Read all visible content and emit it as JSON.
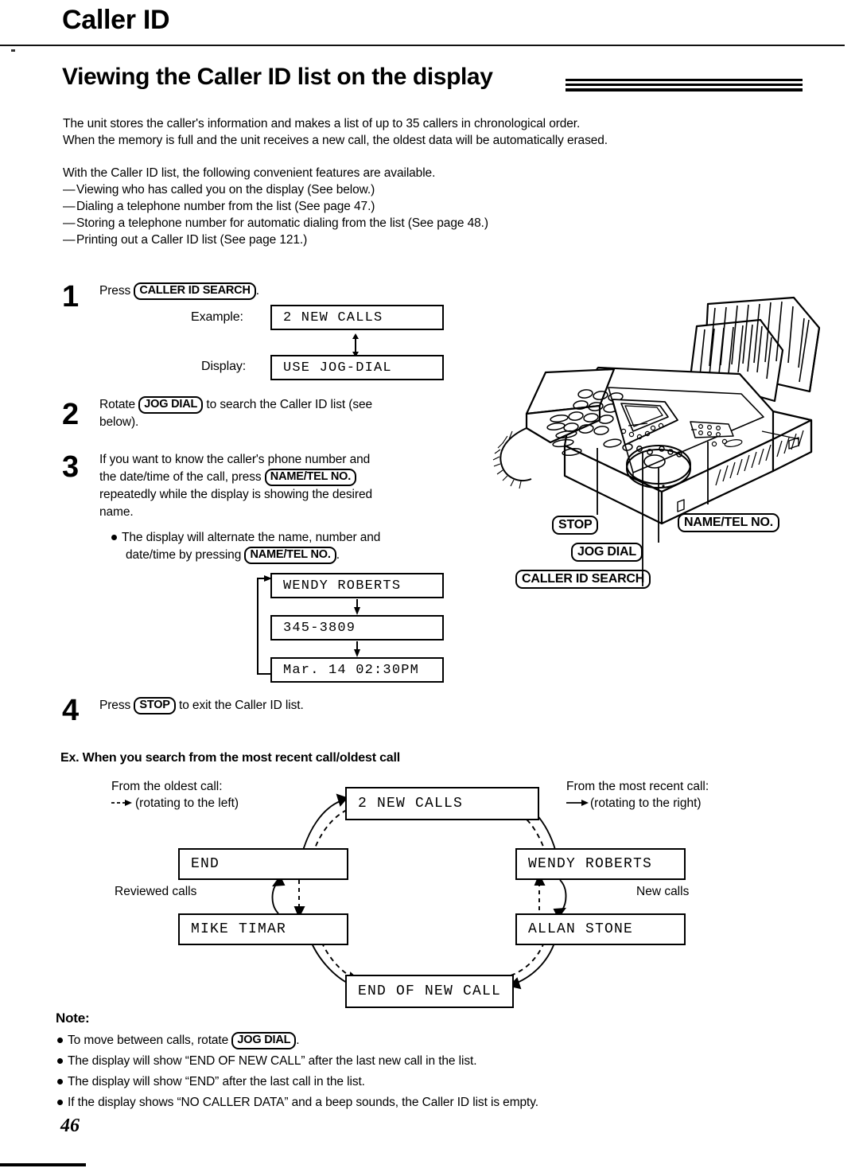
{
  "header": {
    "chapter": "Caller ID",
    "section": "Viewing the Caller ID list on the display"
  },
  "intro": {
    "p1_line1": "The unit stores the caller's information and makes a list of up to 35 callers in chronological order.",
    "p1_line2": "When the memory is full and the unit receives a new call, the oldest data will be automatically erased.",
    "p2": "With the Caller ID list, the following convenient features are available.",
    "bullets": [
      "Viewing who has called you on the display (See below.)",
      "Dialing a telephone number from the list (See page 47.)",
      "Storing a telephone number for automatic dialing from the list (See page 48.)",
      "Printing out a Caller ID list (See page 121.)"
    ]
  },
  "steps": {
    "one": {
      "num": "1",
      "press_label": "Press",
      "key": "CALLER ID SEARCH",
      "period": ".",
      "example_label": "Example:",
      "example_display": "2 NEW CALLS",
      "display_label": "Display:",
      "display_value": "USE JOG-DIAL"
    },
    "two": {
      "num": "2",
      "rotate_label": "Rotate",
      "key": "JOG DIAL",
      "text_after": "to search the Caller ID list (see",
      "line2": "below)."
    },
    "three": {
      "num": "3",
      "line1": "If you want to know the caller's phone number and",
      "line2_a": "the date/time of the call, press",
      "key1": "NAME/TEL NO.",
      "line3": "repeatedly while the display is showing the desired",
      "line4": "name.",
      "bullet_a": "The display will alternate the name, number and",
      "bullet_b": "date/time by pressing",
      "key2": "NAME/TEL NO.",
      "bullet_b_end": ".",
      "cycle": [
        "WENDY ROBERTS",
        "345-3809",
        "Mar. 14 02:30PM"
      ]
    },
    "four": {
      "num": "4",
      "press_label": "Press",
      "key": "STOP",
      "text_after": "to exit the Caller ID list."
    }
  },
  "machine": {
    "callouts": {
      "stop": "STOP",
      "name_tel_no": "NAME/TEL NO.",
      "jog_dial": "JOG DIAL",
      "caller_id_search": "CALLER ID SEARCH"
    }
  },
  "example_section": {
    "heading": "Ex. When you search from the most recent call/oldest call",
    "left_legend_line1": "From the oldest call:",
    "left_legend_line2": "(rotating to the left)",
    "right_legend_line1": "From the most recent call:",
    "right_legend_line2": "(rotating to the right)",
    "label_reviewed": "Reviewed calls",
    "label_new": "New calls",
    "boxes": {
      "top": "2 NEW CALLS",
      "left_upper": "END",
      "right_upper": "WENDY ROBERTS",
      "left_lower": "MIKE TIMAR",
      "right_lower": "ALLAN STONE",
      "bottom": "END OF NEW CALL"
    }
  },
  "note": {
    "heading": "Note:",
    "items": [
      {
        "pre": "To move between calls, rotate",
        "key": "JOG DIAL",
        "post": "."
      },
      {
        "pre": "The display will show “END OF NEW CALL” after the last new call in the list.",
        "key": "",
        "post": ""
      },
      {
        "pre": "The display will show “END” after the last call in the list.",
        "key": "",
        "post": ""
      },
      {
        "pre": "If the display shows “NO CALLER DATA” and a beep sounds, the Caller ID list is empty.",
        "key": "",
        "post": ""
      }
    ]
  },
  "footer": {
    "page_number": "46"
  }
}
